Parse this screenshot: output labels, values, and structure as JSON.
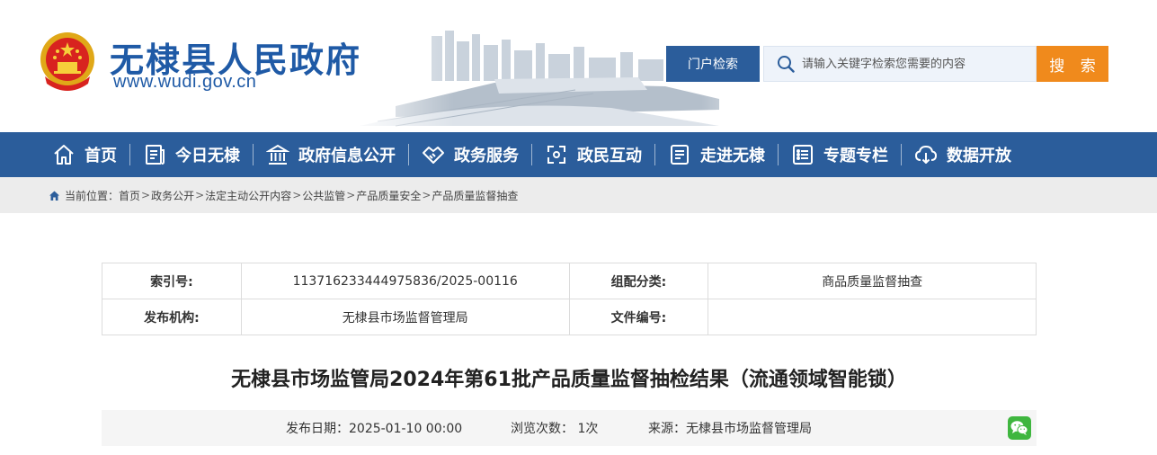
{
  "header": {
    "site_title": "无棣县人民政府",
    "site_url": "www.wudi.gov.cn",
    "portal_search_label": "门户检索",
    "search_placeholder": "请输入关键字检索您需要的内容",
    "search_button_label": "搜 索"
  },
  "nav": {
    "items": [
      {
        "label": "首页",
        "icon": "home-icon"
      },
      {
        "label": "今日无棣",
        "icon": "news-icon"
      },
      {
        "label": "政府信息公开",
        "icon": "government-building-icon"
      },
      {
        "label": "政务服务",
        "icon": "handshake-icon"
      },
      {
        "label": "政民互动",
        "icon": "interaction-icon"
      },
      {
        "label": "走进无棣",
        "icon": "info-card-icon"
      },
      {
        "label": "专题专栏",
        "icon": "list-icon"
      },
      {
        "label": "数据开放",
        "icon": "cloud-download-icon"
      }
    ]
  },
  "breadcrumb": {
    "prefix": "当前位置：",
    "items": [
      "首页",
      "政务公开",
      "法定主动公开内容",
      "公共监管",
      "产品质量安全",
      "产品质量监督抽查"
    ],
    "separator": ">"
  },
  "info": {
    "index_label": "索引号:",
    "index_value": "11371623344497583​6/2025-00116",
    "category_label": "组配分类:",
    "category_value": "商品质量监督抽查",
    "publisher_label": "发布机构:",
    "publisher_value": "无棣县市场监督管理局",
    "doc_no_label": "文件编号:",
    "doc_no_value": ""
  },
  "article": {
    "title": "无棣县市场监管局2024年第61批产品质量监督抽检结果（流通领域智能锁）",
    "date_text": "发布日期：2025-01-10 00:00",
    "views_text": "浏览次数： 1次",
    "source_text": "来源：无棣县市场监督管理局"
  },
  "colors": {
    "primary_blue": "#2b5d9b",
    "accent_orange": "#f08a1c",
    "title_blue": "#1f5aa6"
  }
}
